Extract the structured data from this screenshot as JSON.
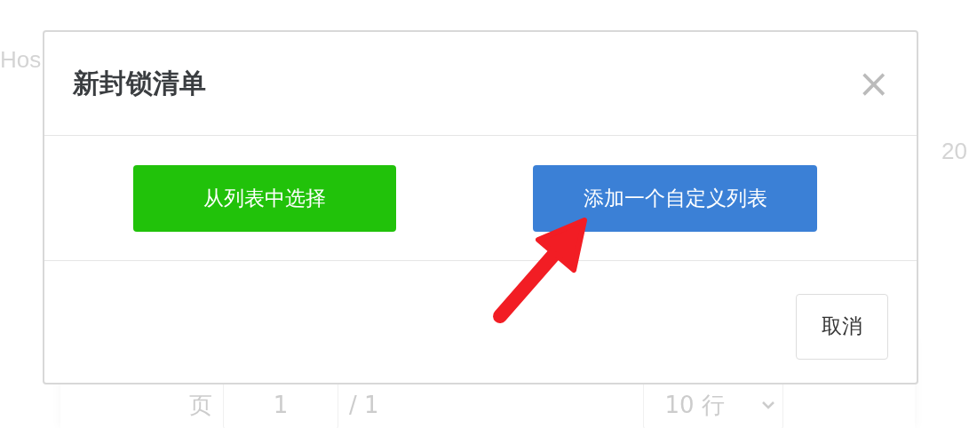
{
  "background": {
    "heading_fragment": "Hos",
    "date_fragment": "20",
    "pagination": {
      "page_label": "页",
      "page_value": "1",
      "page_total": "/ 1",
      "rows_select": "10 行"
    }
  },
  "dialog": {
    "title": "新封锁清单",
    "close": "×",
    "options": [
      {
        "label": "从列表中选择",
        "kind": "green"
      },
      {
        "label": "添加一个自定义列表",
        "kind": "blue"
      }
    ],
    "buttons": [
      "取消"
    ]
  },
  "annotation": {
    "kind": "arrow"
  }
}
